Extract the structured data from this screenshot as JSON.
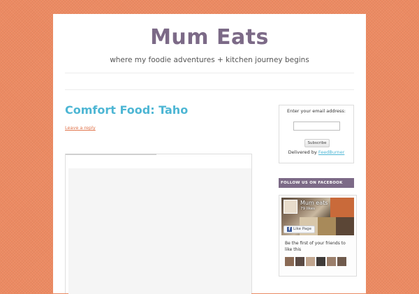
{
  "site": {
    "title": "Mum Eats",
    "tagline": "where my foodie adventures + kitchen journey begins"
  },
  "post": {
    "title": "Comfort Food: Taho",
    "leave_reply": "Leave a reply"
  },
  "subscribe": {
    "label": "Enter your email address:",
    "email_value": "",
    "button_label": "Subscribe",
    "delivered_by": "Delivered by",
    "delivered_link": "FeedBurner"
  },
  "facebook": {
    "heading": "FOLLOW US ON FACEBOOK",
    "page_name": "Mum eats",
    "likes": "79 likes",
    "like_button": "Like Page",
    "friends_text": "Be the first of your friends to like this",
    "face_count": 6
  },
  "colors": {
    "background": "#ec8a62",
    "title": "#7c6a87",
    "post_title": "#4db6d4",
    "link": "#e0734a",
    "widget_heading_bg": "#7c6a87"
  }
}
